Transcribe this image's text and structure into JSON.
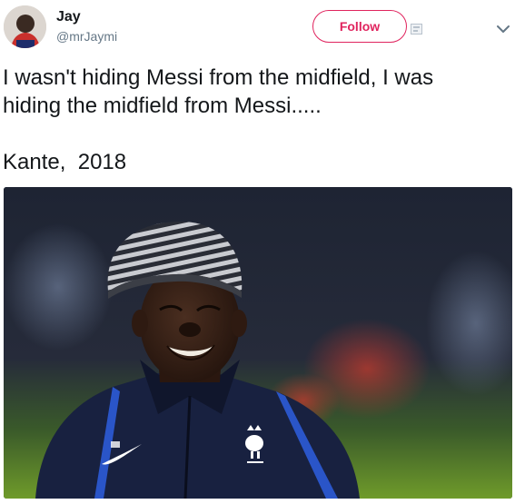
{
  "tweet": {
    "user": {
      "display_name": "Jay",
      "handle": "@mrJaymi"
    },
    "follow_label": "Follow",
    "text": "I wasn't hiding Messi from the midfield, I was\nhiding the midfield from Messi.....\n\nKante,  2018"
  },
  "icons": {
    "follow_extra": "translate-badge-icon",
    "menu": "chevron-down-icon"
  },
  "colors": {
    "follow": "#e0245e",
    "handle": "#657786",
    "text": "#14171a"
  }
}
